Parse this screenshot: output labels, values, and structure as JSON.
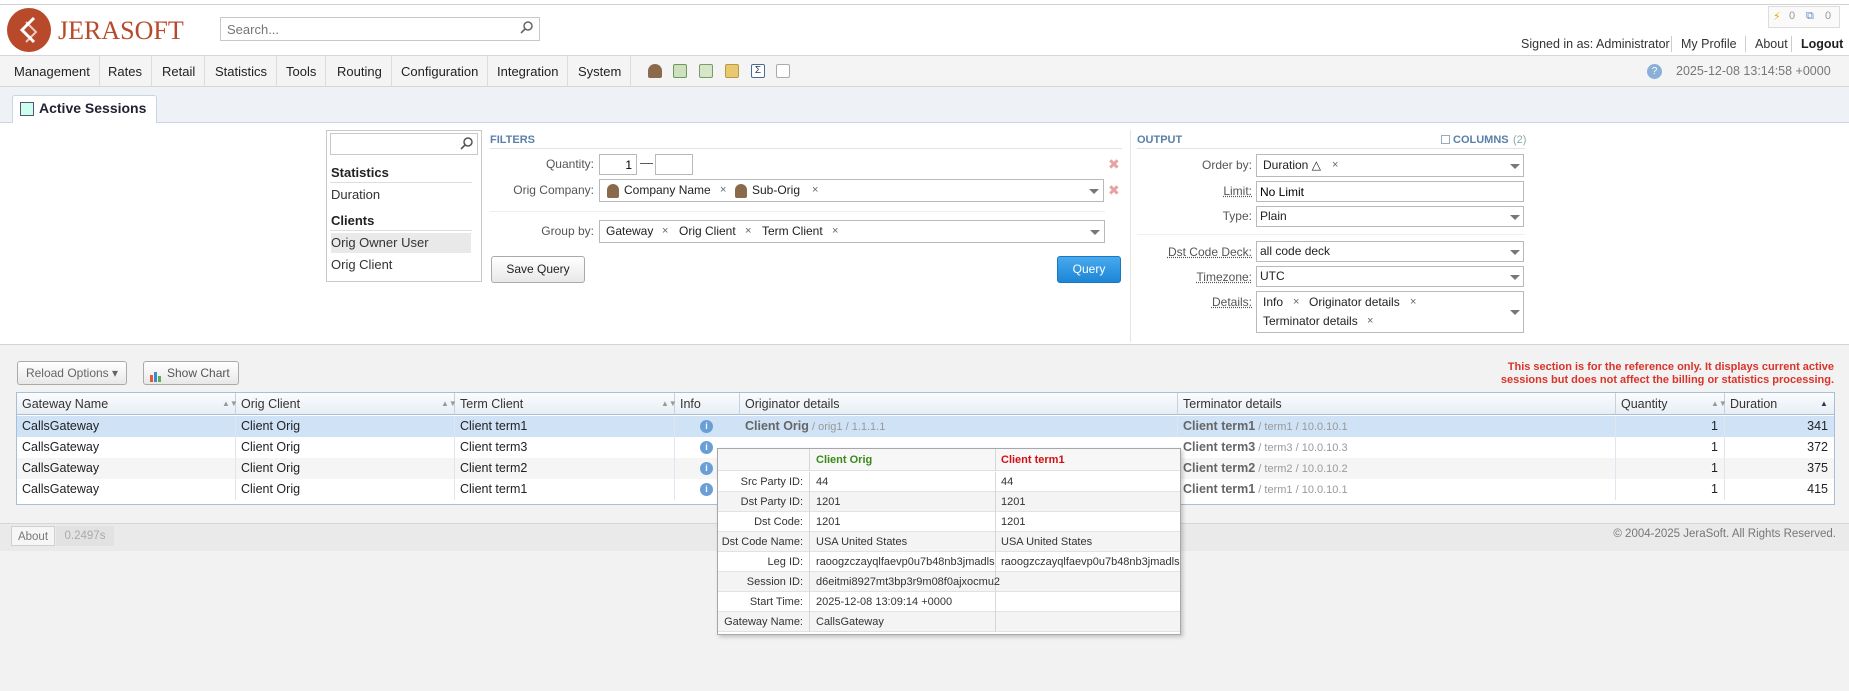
{
  "header": {
    "logo_text": "JERASOFT",
    "search_placeholder": "Search...",
    "notif_alerts": "0",
    "notif_tasks": "0",
    "signed_in": "Signed in as: Administrator",
    "my_profile": "My Profile",
    "about": "About",
    "logout": "Logout"
  },
  "menu": {
    "items": [
      "Management",
      "Rates",
      "Retail",
      "Statistics",
      "Tools",
      "Routing",
      "Configuration",
      "Integration",
      "System"
    ],
    "datetime": "2025-12-08 13:14:58 +0000",
    "help": "?"
  },
  "tab": {
    "title": "Active Sessions"
  },
  "field_list": {
    "group1": "Statistics",
    "item1": "Duration",
    "group2": "Clients",
    "item2": "Orig Owner User",
    "item3": "Orig Client"
  },
  "filters": {
    "heading": "FILTERS",
    "quantity_label": "Quantity:",
    "quantity_from": "1",
    "quantity_to": "",
    "quantity_dash": "—",
    "orig_company_label": "Orig Company:",
    "orig_company_chips": [
      "Company Name",
      "Sub-Orig"
    ],
    "group_by_label": "Group by:",
    "group_by_chips": [
      "Gateway",
      "Orig Client",
      "Term Client"
    ],
    "save_query": "Save Query",
    "query": "Query"
  },
  "output": {
    "heading": "OUTPUT",
    "columns_label": "COLUMNS",
    "columns_count": "(2)",
    "order_by_label": "Order by:",
    "order_by_chip": "Duration △",
    "limit_label": "Limit:",
    "limit_value": "No Limit",
    "type_label": "Type:",
    "type_value": "Plain",
    "dst_code_deck_label": "Dst Code Deck:",
    "dst_code_deck_value": "all code deck",
    "timezone_label": "Timezone:",
    "timezone_value": "UTC",
    "details_label": "Details:",
    "details_chips": [
      "Info",
      "Originator details",
      "Terminator details"
    ]
  },
  "grid": {
    "reload_options": "Reload Options ▾",
    "show_chart": "Show Chart",
    "notice_line1": "This section is for the reference only. It displays current active",
    "notice_line2": "sessions but does not affect the billing or statistics processing.",
    "columns": [
      "Gateway Name",
      "Orig Client",
      "Term Client",
      "Info",
      "Originator details",
      "Terminator details",
      "Quantity",
      "Duration"
    ],
    "rows": [
      {
        "gateway": "CallsGateway",
        "orig": "Client Orig",
        "term": "Client term1",
        "orig_strong": "Client Orig",
        "orig_sub": " / orig1 / 1.1.1.1",
        "term_strong": "Client term1",
        "term_sub": " / term1 / 10.0.10.1",
        "quantity": "1",
        "duration": "341"
      },
      {
        "gateway": "CallsGateway",
        "orig": "Client Orig",
        "term": "Client term3",
        "orig_strong": "",
        "orig_sub": "",
        "term_strong": "Client term3",
        "term_sub": " / term3 / 10.0.10.3",
        "quantity": "1",
        "duration": "372"
      },
      {
        "gateway": "CallsGateway",
        "orig": "Client Orig",
        "term": "Client term2",
        "orig_strong": "",
        "orig_sub": "",
        "term_strong": "Client term2",
        "term_sub": " / term2 / 10.0.10.2",
        "quantity": "1",
        "duration": "375"
      },
      {
        "gateway": "CallsGateway",
        "orig": "Client Orig",
        "term": "Client term1",
        "orig_strong": "",
        "orig_sub": "",
        "term_strong": "Client term1",
        "term_sub": " / term1 / 10.0.10.1",
        "quantity": "1",
        "duration": "415"
      }
    ]
  },
  "popup": {
    "col1": "Client Orig",
    "col2": "Client term1",
    "col1_color": "#3a8a1a",
    "col2_color": "#d01010",
    "rows": [
      {
        "label": "Src Party ID:",
        "v1": "44",
        "v2": "44"
      },
      {
        "label": "Dst Party ID:",
        "v1": "1201",
        "v2": "1201"
      },
      {
        "label": "Dst Code:",
        "v1": "1201",
        "v2": "1201"
      },
      {
        "label": "Dst Code Name:",
        "v1": "USA United States",
        "v2": "USA United States"
      },
      {
        "label": "Leg ID:",
        "v1": "raoogzczayqlfaevp0u7b48nb3jmadls",
        "v2": "raoogzczayqlfaevp0u7b48nb3jmadls"
      },
      {
        "label": "Session ID:",
        "v1": "d6eitmi8927mt3bp3r9m08f0ajxocmu2",
        "v2": ""
      },
      {
        "label": "Start Time:",
        "v1": "2025-12-08 13:09:14 +0000",
        "v2": ""
      },
      {
        "label": "Gateway Name:",
        "v1": "CallsGateway",
        "v2": ""
      }
    ]
  },
  "footer": {
    "about": "About",
    "timing": "0.2497s",
    "copyright": "© 2004-2025 JeraSoft. All Rights Reserved."
  }
}
